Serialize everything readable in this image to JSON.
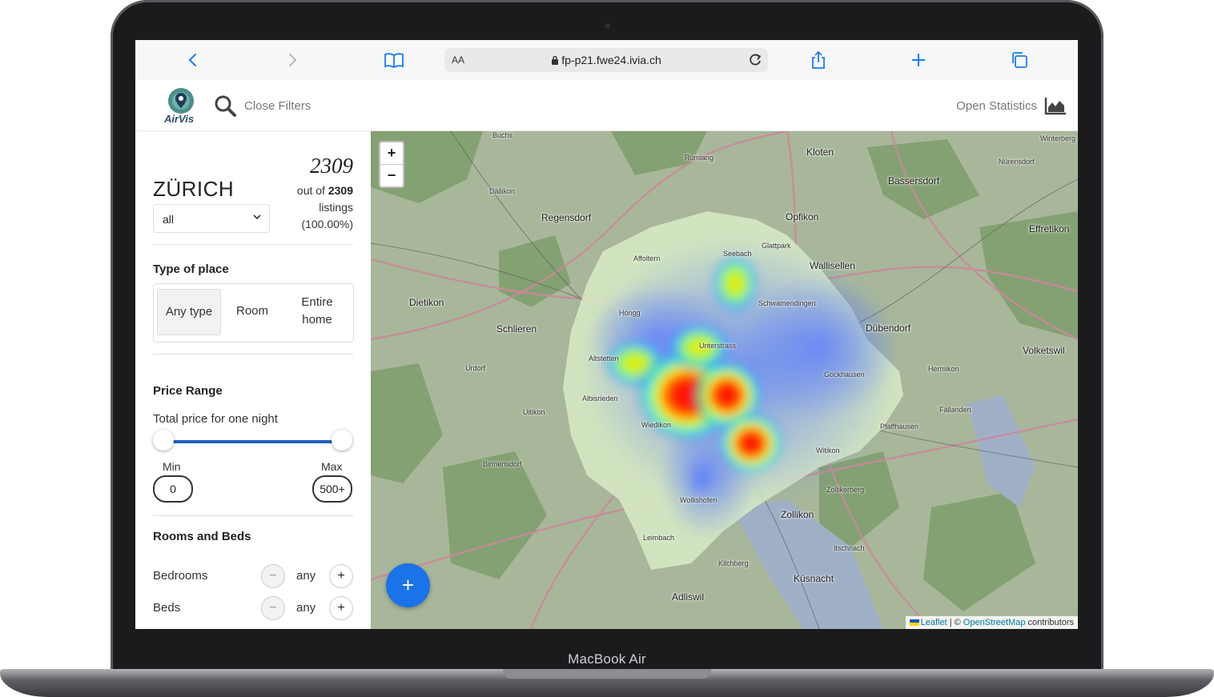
{
  "device": {
    "brand": "MacBook Air"
  },
  "browser": {
    "font_size_label": "AA",
    "url": "fp-p21.fwe24.ivia.ch"
  },
  "header": {
    "logo_text": "AirVis",
    "close_filters": "Close Filters",
    "open_statistics": "Open Statistics"
  },
  "sidebar": {
    "city": "ZÜRICH",
    "neighbourhood_select": "all",
    "count": "2309",
    "count_prefix": "out of",
    "count_total": "2309",
    "count_suffix": "listings",
    "count_percent": "(100.00%)",
    "type_of_place": {
      "title": "Type of place",
      "options": [
        "Any type",
        "Room",
        "Entire home"
      ],
      "selected": "Any type"
    },
    "price_range": {
      "title": "Price Range",
      "subtitle": "Total price for one night",
      "min_label": "Min",
      "max_label": "Max",
      "min_value": "0",
      "max_value": "500+"
    },
    "rooms_and_beds": {
      "title": "Rooms and Beds",
      "rows": [
        {
          "label": "Bedrooms",
          "value": "any"
        },
        {
          "label": "Beds",
          "value": "any"
        }
      ],
      "minus_symbol": "−",
      "plus_symbol": "+"
    }
  },
  "map": {
    "zoom_in": "+",
    "zoom_out": "−",
    "fab": "+",
    "attribution": {
      "leaflet": "Leaflet",
      "separator": "| ©",
      "osm": "OpenStreetMap",
      "suffix": "contributors"
    },
    "places": [
      "Kloten",
      "Bassersdorf",
      "Opfikon",
      "Wallisellen",
      "Regensdorf",
      "Affoltern",
      "Seebach",
      "Glattpark",
      "Schwamendingen",
      "Dübendorf",
      "Dietikon",
      "Schlieren",
      "Höngg",
      "Unterstrass",
      "Altstetten",
      "Albisrieden",
      "Wiedikon",
      "Gockhausen",
      "Witikon",
      "Zollikerberg",
      "Zollikon",
      "Wollishofen",
      "Leimbach",
      "Adliswil",
      "Küsnacht",
      "Itschnach",
      "Volketswil",
      "Hermikon",
      "Fällanden",
      "Pfaffhausen",
      "Uitikon",
      "Urdorf",
      "Birmensdorf",
      "Kilchberg",
      "Rümlang",
      "Dällikon",
      "Buchs",
      "Winterberg",
      "Nürensdorf",
      "Effretikon"
    ]
  }
}
